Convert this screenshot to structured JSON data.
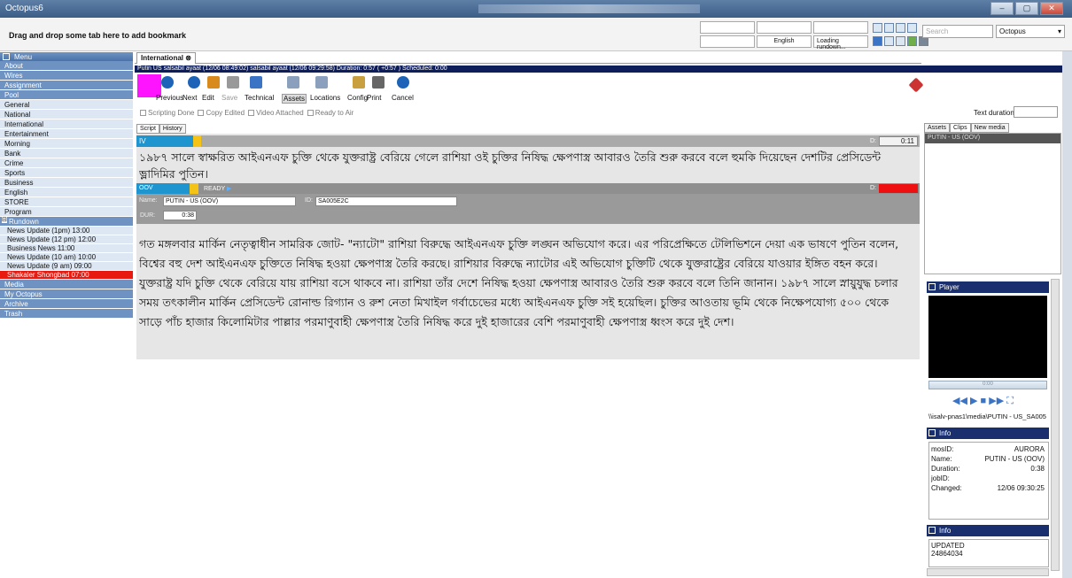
{
  "window": {
    "title": "Octopus6",
    "controls": [
      "–",
      "▢",
      "✕"
    ]
  },
  "toolbar_top": {
    "bookmark_hint": "Drag and drop some tab here to add bookmark",
    "language": "English",
    "rundown_status": "Loading rundown...",
    "search_placeholder": "Search",
    "app_select": "Octopus"
  },
  "sidebar": {
    "menu": "Menu",
    "items_top": [
      "About",
      "Wires",
      "Assignment",
      "Pool"
    ],
    "pool_children": [
      "General",
      "National",
      "International",
      "Entertainment",
      "Morning",
      "Bank",
      "Crime",
      "Sports",
      "Business",
      "English",
      "STORE",
      "Program"
    ],
    "rundown": "Rundown",
    "rundown_children": [
      "News Update (1pm) 13:00",
      "News Update (12 pm) 12:00",
      "Business News 11:00",
      "News Update (10 am) 10:00",
      "News Update (9 am) 09:00",
      "Shakaler Shongbad 07:00"
    ],
    "items_bottom": [
      "Media",
      "My Octopus",
      "Archive",
      "Trash"
    ]
  },
  "main": {
    "tab": "International",
    "storybar": "Putin US  salsabil ayaat (12/06 08:49:02)  salsabil ayaat (12/06 09:29:58)  Duration:  0:57  ( +0:57 )  Scheduled:  0:00",
    "buttons": [
      "Previous",
      "Next",
      "Edit",
      "Save",
      "Technical",
      "Assets",
      "Locations",
      "Config",
      "Print",
      "Cancel"
    ],
    "checks": [
      "Scripting Done",
      "Copy Edited",
      "Video Attached",
      "Ready to Air"
    ],
    "subtabs": [
      "Script",
      "History"
    ],
    "iv": {
      "label": "IV",
      "d_label": "D:",
      "duration": "0:11",
      "text": "১৯৮৭ সালে স্বাক্ষরিত আইএনএফ চুক্তি থেকে যুক্তরাষ্ট্র বেরিয়ে গেলে রাশিয়া ওই চুক্তির নিষিদ্ধ ক্ষেপণাস্ত্র আবারও তৈরি শুরু করবে বলে হুমকি দিয়েছেন দেশটির প্রেসিডেন্ট ভ্লাদিমির পুতিন।"
    },
    "oov": {
      "label": "OOV",
      "status": "READY",
      "d_label": "D:",
      "name_label": "Name:",
      "name": "PUTIN - US (OOV)",
      "id_label": "ID:",
      "id": "SA005E2C",
      "dur_label": "DUR:",
      "dur": "0:38"
    },
    "body_text": "গত মঙ্গলবার মার্কিন নেতৃত্বাধীন সামরিক জোট- \"ন্যাটো\" রাশিয়া বিরুদ্ধে আইএনএফ চুক্তি লঙ্ঘন অভিযোগ করে। এর পরিপ্রেক্ষিতে টেলিভিশনে দেয়া এক ভাষণে পুতিন বলেন, বিশ্বের বহু দেশ আইএনএফ চুক্তিতে নিষিদ্ধ হওয়া ক্ষেপণাস্ত্র তৈরি করছে। রাশিয়ার বিরুদ্ধে ন্যাটোর এই অভিযোগ চুক্তিটি থেকে যুক্তরাষ্ট্রের বেরিয়ে যাওয়ার ইঙ্গিত বহন করে। যুক্তরাষ্ট্র যদি চুক্তি থেকে বেরিয়ে যায় রাশিয়া বসে থাকবে না। রাশিয়া তাঁর দেশে নিষিদ্ধ হওয়া ক্ষেপণাস্ত্র আবারও তৈরি শুরু করবে বলে তিনি জানান। ১৯৮৭ সালে স্নায়ুযুদ্ধ চলার সময় তৎকালীন মার্কিন প্রেসিডেন্ট রোনাল্ড রিগ্যান ও রুশ নেতা মিখাইল গর্বাচেভের মধ্যে আইএনএফ চুক্তি সই হয়েছিল। চুক্তির আওতায় ভূমি থেকে নিক্ষেপযোগ্য ৫০০ থেকে সাড়ে পাঁচ হাজার কিলোমিটার পাল্লার পরমাণুবাহী ক্ষেপণাস্ত্র তৈরি নিষিদ্ধ করে দুই হাজারের বেশি পরমাণুবাহী ক্ষেপণাস্ত্র ধ্বংস করে দুই দেশ।"
  },
  "right": {
    "text_duration_label": "Text duration:",
    "tabs": [
      "Assets",
      "Clips",
      "New media"
    ],
    "clip_item": "PUTIN - US (OOV)",
    "player_title": "Player",
    "player_time": "0:00",
    "path": "\\\\isalv-pnas1\\media\\PUTIN - US_SA005",
    "info_title": "Info",
    "info": [
      {
        "k": "mosID:",
        "v": "AURORA"
      },
      {
        "k": "Name:",
        "v": "PUTIN - US (OOV)"
      },
      {
        "k": "Duration:",
        "v": "0:38"
      },
      {
        "k": "jobID:",
        "v": ""
      },
      {
        "k": "Changed:",
        "v": "12/06 09:30:25"
      }
    ],
    "info2_title": "Info",
    "info2": [
      "UPDATED",
      "24864034"
    ]
  },
  "colors": {
    "accent_blue": "#1e95cf",
    "ready_yellow": "#f5c315",
    "alert_red": "#ee1010",
    "magenta_tag": "#ff14ff",
    "storybar_navy": "#0e1e5a"
  }
}
